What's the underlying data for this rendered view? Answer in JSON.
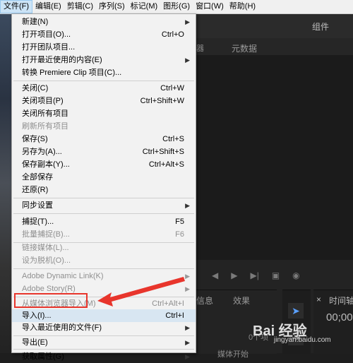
{
  "menubar": {
    "items": [
      {
        "label": "文件(F)",
        "active": true
      },
      {
        "label": "编辑(E)"
      },
      {
        "label": "剪辑(C)"
      },
      {
        "label": "序列(S)"
      },
      {
        "label": "标记(M)"
      },
      {
        "label": "图形(G)"
      },
      {
        "label": "窗口(W)"
      },
      {
        "label": "帮助(H)"
      }
    ]
  },
  "file_menu": {
    "items": [
      {
        "label": "新建(N)",
        "shortcut": "",
        "submenu": true,
        "disabled": false
      },
      {
        "label": "打开项目(O)...",
        "shortcut": "Ctrl+O",
        "submenu": false,
        "disabled": false
      },
      {
        "label": "打开团队项目...",
        "shortcut": "",
        "submenu": false,
        "disabled": false
      },
      {
        "label": "打开最近使用的内容(E)",
        "shortcut": "",
        "submenu": true,
        "disabled": false
      },
      {
        "label": "转换 Premiere Clip 项目(C)...",
        "shortcut": "",
        "submenu": false,
        "disabled": false
      },
      {
        "label": "关闭(C)",
        "shortcut": "Ctrl+W",
        "submenu": false,
        "disabled": false
      },
      {
        "label": "关闭项目(P)",
        "shortcut": "Ctrl+Shift+W",
        "submenu": false,
        "disabled": false
      },
      {
        "label": "关闭所有项目",
        "shortcut": "",
        "submenu": false,
        "disabled": false
      },
      {
        "label": "刷新所有项目",
        "shortcut": "",
        "submenu": false,
        "disabled": true
      },
      {
        "label": "保存(S)",
        "shortcut": "Ctrl+S",
        "submenu": false,
        "disabled": false
      },
      {
        "label": "另存为(A)...",
        "shortcut": "Ctrl+Shift+S",
        "submenu": false,
        "disabled": false
      },
      {
        "label": "保存副本(Y)...",
        "shortcut": "Ctrl+Alt+S",
        "submenu": false,
        "disabled": false
      },
      {
        "label": "全部保存",
        "shortcut": "",
        "submenu": false,
        "disabled": false
      },
      {
        "label": "还原(R)",
        "shortcut": "",
        "submenu": false,
        "disabled": false
      },
      {
        "label": "同步设置",
        "shortcut": "",
        "submenu": true,
        "disabled": false
      },
      {
        "label": "捕捉(T)...",
        "shortcut": "F5",
        "submenu": false,
        "disabled": false
      },
      {
        "label": "批量捕捉(B)...",
        "shortcut": "F6",
        "submenu": false,
        "disabled": true
      },
      {
        "label": "链接媒体(L)...",
        "shortcut": "",
        "submenu": false,
        "disabled": true
      },
      {
        "label": "设为脱机(O)...",
        "shortcut": "",
        "submenu": false,
        "disabled": true
      },
      {
        "label": "Adobe Dynamic Link(K)",
        "shortcut": "",
        "submenu": true,
        "disabled": true
      },
      {
        "label": "Adobe Story(R)",
        "shortcut": "",
        "submenu": true,
        "disabled": true
      },
      {
        "label": "从媒体浏览器导入(M)",
        "shortcut": "Ctrl+Alt+I",
        "submenu": false,
        "disabled": true
      },
      {
        "label": "导入(I)...",
        "shortcut": "Ctrl+I",
        "submenu": false,
        "disabled": false,
        "highlight": true
      },
      {
        "label": "导入最近使用的文件(F)",
        "shortcut": "",
        "submenu": true,
        "disabled": false
      },
      {
        "label": "导出(E)",
        "shortcut": "",
        "submenu": true,
        "disabled": false
      },
      {
        "label": "获取属性(G)",
        "shortcut": "",
        "submenu": true,
        "disabled": false
      }
    ]
  },
  "background": {
    "components_label": "组件",
    "tab_partial": "器",
    "metadata_tab": "元数据",
    "info_partial": "信息",
    "effects_tab": "效果",
    "item_count": "0个项",
    "media_start": "媒体开始",
    "timeline_close": "×",
    "timeline_label": "时间轴",
    "timecode": "00;00"
  },
  "watermark": {
    "text": "Bai 经验",
    "sub": "jingyan.baidu.com"
  },
  "colors": {
    "annotation": "#e8352c",
    "menu_bg": "#f2f2f2",
    "app_bg": "#232323"
  }
}
